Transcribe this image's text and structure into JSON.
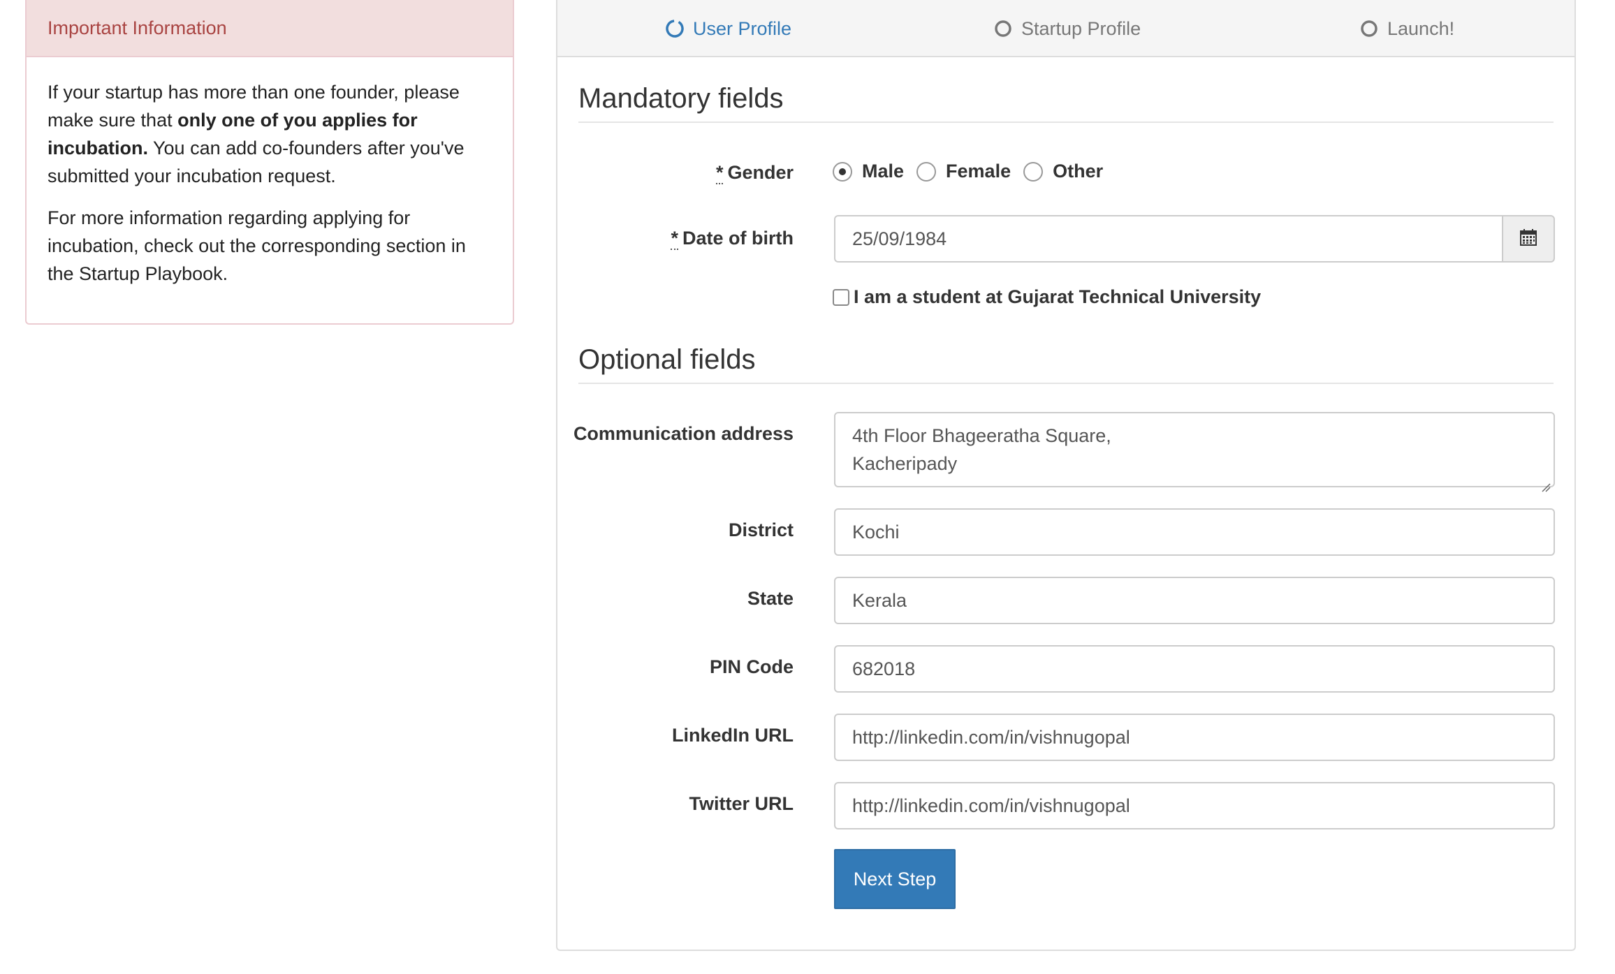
{
  "info": {
    "heading": "Important Information",
    "p1_text_a": "If your startup has more than one founder, please make sure that ",
    "p1_bold": "only one of you applies for incubation.",
    "p1_text_b": " You can add co-founders after you've submitted your incubation request.",
    "p2": "For more information regarding applying for incubation, check out the corresponding section in the Startup Playbook."
  },
  "wizard": {
    "steps": [
      {
        "label": "User Profile",
        "state": "active"
      },
      {
        "label": "Startup Profile",
        "state": "pending"
      },
      {
        "label": "Launch!",
        "state": "pending"
      }
    ]
  },
  "mandatory": {
    "title": "Mandatory fields",
    "gender": {
      "label": "Gender",
      "required_mark": "*",
      "options": [
        "Male",
        "Female",
        "Other"
      ],
      "selected": "Male"
    },
    "dob": {
      "label": "Date of birth",
      "required_mark": "*",
      "value": "25/09/1984"
    },
    "student_checkbox": {
      "label": "I am a student at Gujarat Technical University",
      "checked": false
    }
  },
  "optional": {
    "title": "Optional fields",
    "address": {
      "label": "Communication address",
      "line1": "4th Floor Bhageeratha Square,",
      "line2": "Kacheripady"
    },
    "district": {
      "label": "District",
      "value": "Kochi"
    },
    "state": {
      "label": "State",
      "value": "Kerala"
    },
    "pin": {
      "label": "PIN Code",
      "value": "682018"
    },
    "linkedin": {
      "label": "LinkedIn URL",
      "value": "http://linkedin.com/in/vishnugopal"
    },
    "twitter": {
      "label": "Twitter URL",
      "value": "http://linkedin.com/in/vishnugopal"
    }
  },
  "actions": {
    "next_label": "Next Step"
  },
  "colors": {
    "primary": "#337ab7",
    "danger_text": "#a94442",
    "danger_bg": "#f2dede",
    "danger_border": "#ebccd1"
  },
  "icons": {
    "active_step": "spinner-icon",
    "pending_step": "circle-icon",
    "date_addon": "calendar-icon"
  }
}
